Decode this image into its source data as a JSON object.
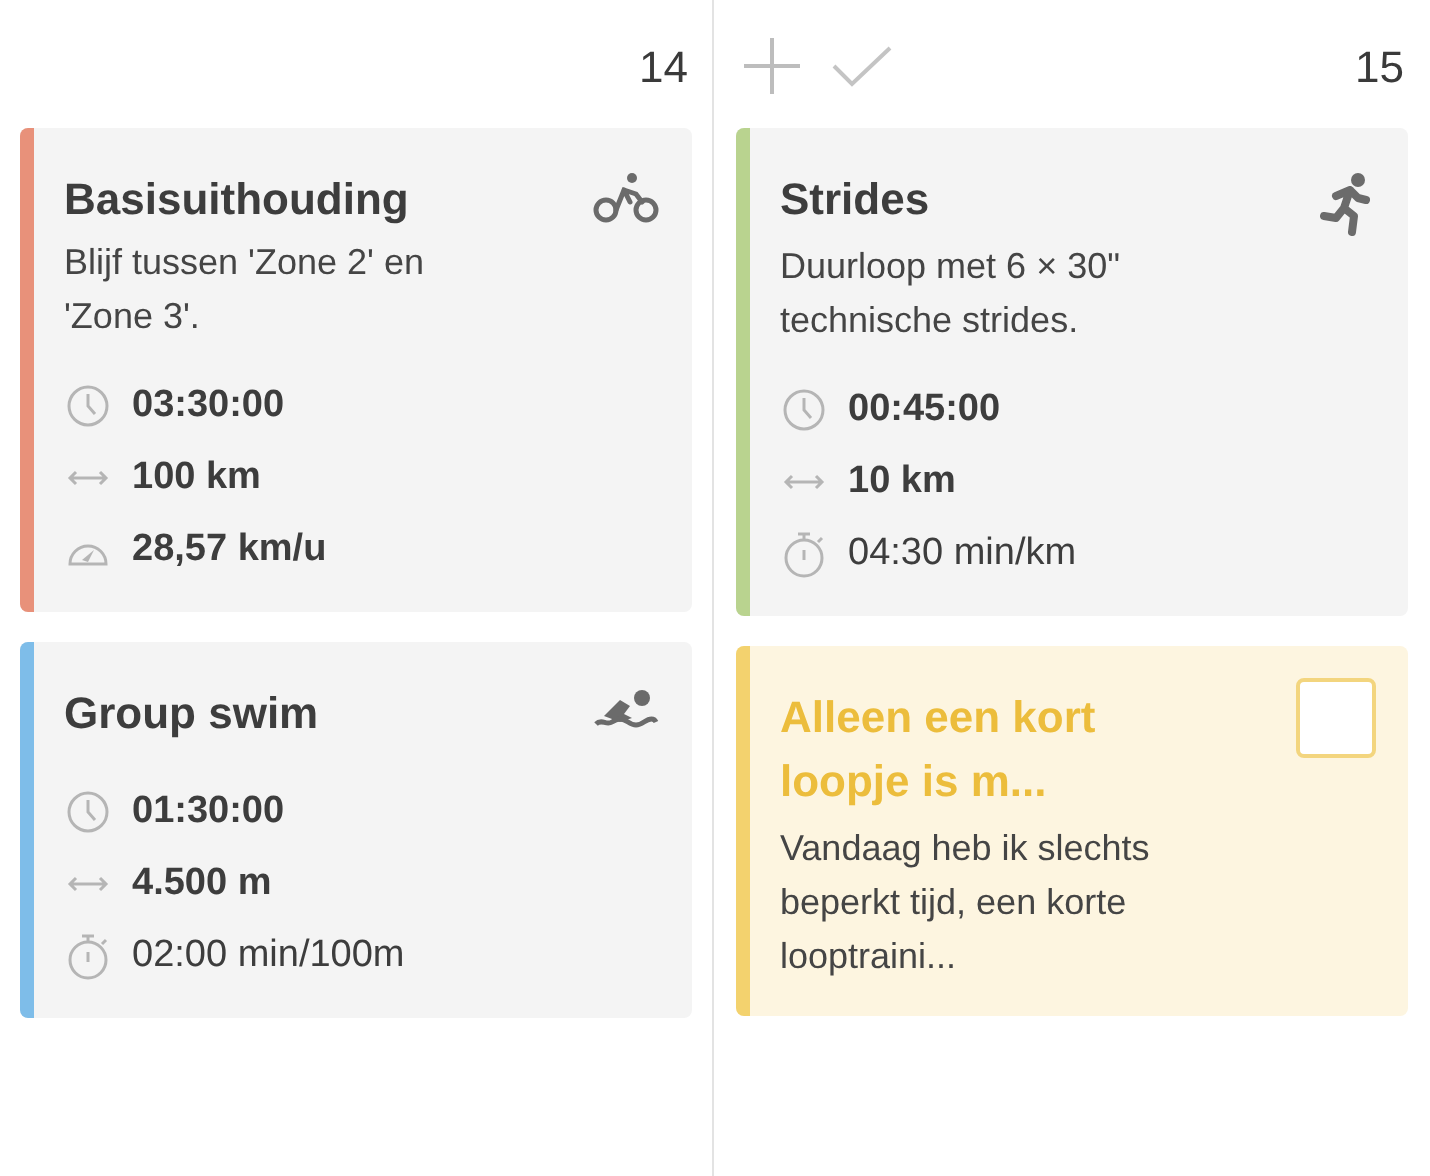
{
  "days": [
    {
      "number": "14",
      "cards": [
        {
          "kind": "bike",
          "color": "#e8917a",
          "title": [
            "Basisuithouding"
          ],
          "description": [
            "Blijf tussen 'Zone 2' en",
            "'Zone 3'."
          ],
          "stats": [
            {
              "kind": "duration",
              "value": "03:30:00"
            },
            {
              "kind": "distance",
              "value": "100 km"
            },
            {
              "kind": "speed",
              "value": "28,57 km/u"
            }
          ]
        },
        {
          "kind": "swim",
          "color": "#7ebde9",
          "title": [
            "Group swim"
          ],
          "stats": [
            {
              "kind": "duration",
              "value": "01:30:00"
            },
            {
              "kind": "distance",
              "value": "4.500 m"
            },
            {
              "kind": "pace",
              "value": "02:00 min/100m"
            }
          ]
        }
      ]
    },
    {
      "number": "15",
      "actions": [
        {
          "kind": "add"
        },
        {
          "kind": "complete"
        }
      ],
      "cards": [
        {
          "kind": "run",
          "color": "#b9d38f",
          "title": [
            "Strides"
          ],
          "description": [
            "Duurloop met 6 × 30\"",
            "technische strides."
          ],
          "stats": [
            {
              "kind": "duration",
              "value": "00:45:00"
            },
            {
              "kind": "distance",
              "value": "10 km"
            },
            {
              "kind": "pace",
              "value": "04:30 min/km"
            }
          ]
        },
        {
          "kind": "note",
          "color": "#f3d26e",
          "checked": false,
          "title": [
            "Alleen een kort",
            "loopje is m..."
          ],
          "description": [
            "Vandaag heb ik slechts",
            "beperkt tijd, een korte",
            "looptraini..."
          ]
        }
      ]
    }
  ]
}
